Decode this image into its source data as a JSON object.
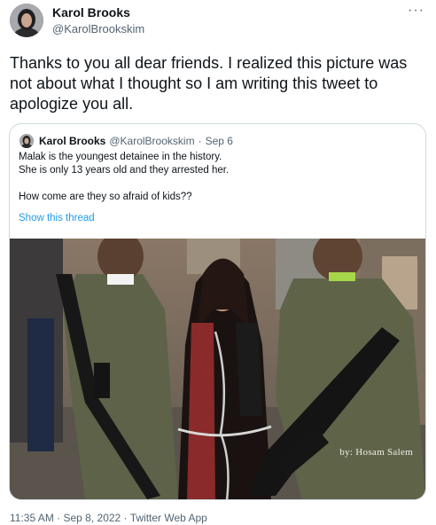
{
  "author": {
    "name": "Karol Brooks",
    "handle": "@KarolBrookskim"
  },
  "tweet_text": "Thanks to you all dear friends. I realized this picture was not about what I thought so I am writing this tweet to apologize you all.",
  "quoted": {
    "name": "Karol Brooks",
    "handle": "@KarolBrookskim",
    "separator": "·",
    "date": "Sep 6",
    "line1": "Malak is the youngest detainee in the history.",
    "line2": "She is only 13 years old and they arrested her.",
    "line3": "How come are they so afraid of kids??",
    "show_thread": "Show this thread",
    "image_credit": "by: Hosam Salem"
  },
  "meta": {
    "time": "11:35 AM",
    "separator": "·",
    "date": "Sep 8, 2022",
    "separator2": "·",
    "source": "Twitter Web App"
  },
  "colors": {
    "link": "#1d9bf0",
    "secondary_text": "#536471",
    "border": "#cfd9de"
  },
  "icons": {
    "more": "more-horizontal-icon"
  }
}
